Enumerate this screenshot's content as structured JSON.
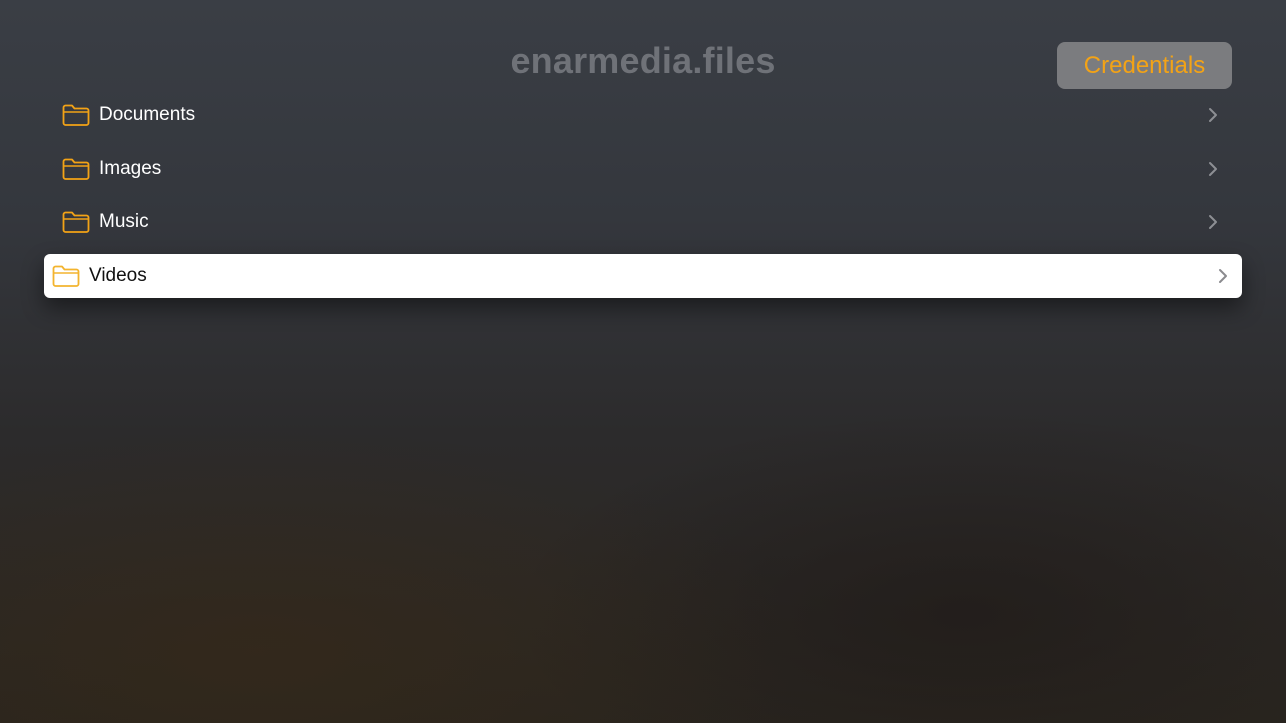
{
  "header": {
    "title": "enarmedia.files",
    "credentials_label": "Credentials"
  },
  "folders": [
    {
      "label": "Documents",
      "icon": "folder-icon",
      "focused": false
    },
    {
      "label": "Images",
      "icon": "folder-icon",
      "focused": false
    },
    {
      "label": "Music",
      "icon": "folder-icon",
      "focused": false
    },
    {
      "label": "Videos",
      "icon": "folder-icon",
      "focused": true
    }
  ],
  "colors": {
    "accent": "#f3a316",
    "title": "#6f7278",
    "button_bg": "#7b7c7f"
  }
}
